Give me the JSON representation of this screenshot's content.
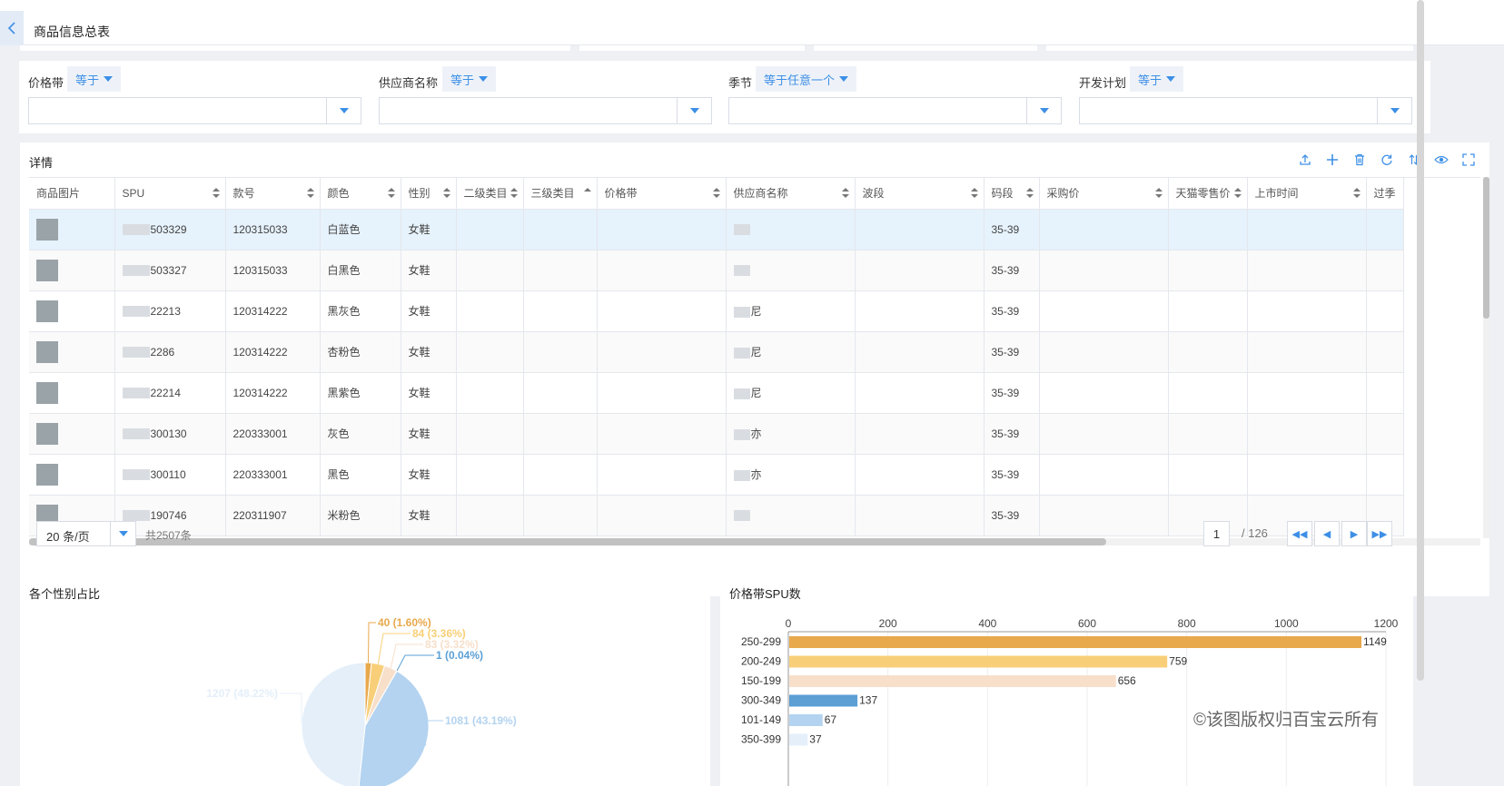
{
  "header": {
    "title": "商品信息总表"
  },
  "filters": [
    {
      "label": "价格带",
      "operator": "等于",
      "value": ""
    },
    {
      "label": "供应商名称",
      "operator": "等于",
      "value": ""
    },
    {
      "label": "季节",
      "operator": "等于任意一个",
      "value": ""
    },
    {
      "label": "开发计划",
      "operator": "等于",
      "value": ""
    }
  ],
  "detail": {
    "title": "详情",
    "toolbar": [
      "upload-icon",
      "add-icon",
      "delete-icon",
      "refresh-icon",
      "sort-icon",
      "view-icon",
      "fullscreen-icon"
    ],
    "columns": [
      "商品图片",
      "SPU",
      "款号",
      "颜色",
      "性别",
      "二级类目",
      "三级类目",
      "价格带",
      "供应商名称",
      "波段",
      "码段",
      "采购价",
      "天猫零售价",
      "上市时间",
      "过季"
    ],
    "rows": [
      {
        "spu": "503329",
        "style": "120315033",
        "color": "白蓝色",
        "gender": "女鞋",
        "supplier": "",
        "size": "35-39"
      },
      {
        "spu": "503327",
        "style": "120315033",
        "color": "白黑色",
        "gender": "女鞋",
        "supplier": "",
        "size": "35-39"
      },
      {
        "spu": "22213",
        "style": "120314222",
        "color": "黑灰色",
        "gender": "女鞋",
        "supplier": "尼",
        "size": "35-39"
      },
      {
        "spu": "2286",
        "style": "120314222",
        "color": "杏粉色",
        "gender": "女鞋",
        "supplier": "尼",
        "size": "35-39"
      },
      {
        "spu": "22214",
        "style": "120314222",
        "color": "黑紫色",
        "gender": "女鞋",
        "supplier": "尼",
        "size": "35-39"
      },
      {
        "spu": "300130",
        "style": "220333001",
        "color": "灰色",
        "gender": "女鞋",
        "supplier": "亦",
        "size": "35-39"
      },
      {
        "spu": "300110",
        "style": "220333001",
        "color": "黑色",
        "gender": "女鞋",
        "supplier": "亦",
        "size": "35-39"
      },
      {
        "spu": "190746",
        "style": "220311907",
        "color": "米粉色",
        "gender": "女鞋",
        "supplier": "",
        "size": "35-39"
      }
    ],
    "pager": {
      "page_size": "20 条/页",
      "total": "共2507条",
      "current": "1",
      "pages": "/ 126"
    }
  },
  "charts": {
    "gender": {
      "title": "各个性别占比"
    },
    "price": {
      "title": "价格带SPU数"
    }
  },
  "chart_data": [
    {
      "type": "pie",
      "title": "各个性别占比",
      "slices": [
        {
          "label": "40 (1.60%)",
          "value": 40,
          "color": "#e8a84c"
        },
        {
          "label": "84 (3.36%)",
          "value": 84,
          "color": "#f8cf78"
        },
        {
          "label": "83 (3.32%)",
          "value": 83,
          "color": "#f7dfca"
        },
        {
          "label": "1 (0.04%)",
          "value": 1,
          "color": "#5b9fd4"
        },
        {
          "label": "1081 (43.19%)",
          "value": 1081,
          "color": "#b3d3f0"
        },
        {
          "label": "1207 (48.22%)",
          "value": 1207,
          "color": "#e4eff9"
        }
      ]
    },
    {
      "type": "bar",
      "orientation": "horizontal",
      "title": "价格带SPU数",
      "categories": [
        "250-299",
        "200-249",
        "150-199",
        "300-349",
        "101-149",
        "350-399"
      ],
      "values": [
        1149,
        759,
        656,
        137,
        67,
        37
      ],
      "colors": [
        "#e8a84c",
        "#f8cf78",
        "#f7dfca",
        "#5b9fd4",
        "#b3d3f0",
        "#e4eff9"
      ],
      "xlim": [
        0,
        1200
      ],
      "xticks": [
        0,
        200,
        400,
        600,
        800,
        1000,
        1200
      ],
      "grid": true
    }
  ],
  "watermark": "©该图版权归百宝云所有"
}
